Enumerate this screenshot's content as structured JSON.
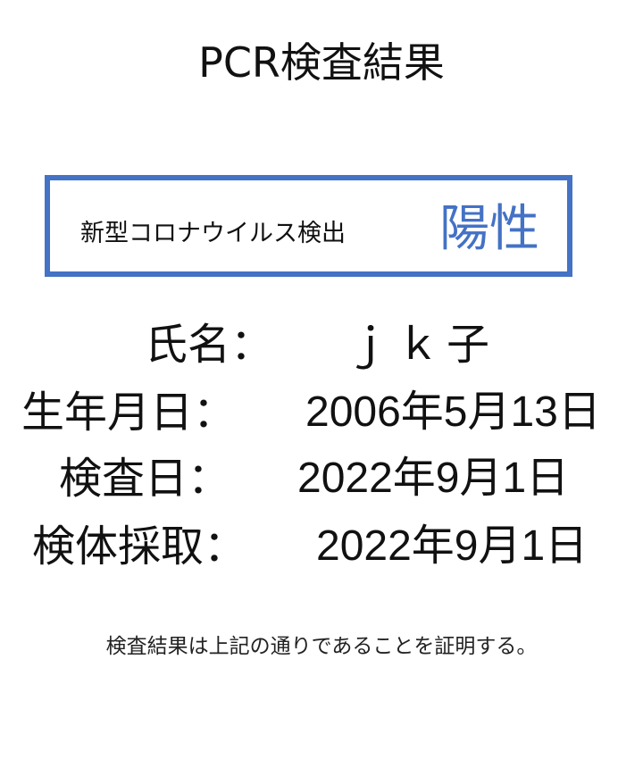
{
  "document": {
    "title": "PCR検査結果",
    "result": {
      "label": "新型コロナウイルス検出",
      "value": "陽性",
      "accent_color": "#4472c4"
    },
    "fields": {
      "name": {
        "label": "氏名：",
        "value": "ｊｋ子"
      },
      "birthdate": {
        "label": "生年月日：",
        "value": "2006年5月13日"
      },
      "test_date": {
        "label": "検査日：",
        "value": "2022年9月1日"
      },
      "sample_date": {
        "label": "検体採取：",
        "value": "2022年9月1日"
      }
    },
    "certification": "検査結果は上記の通りであることを証明する。"
  }
}
